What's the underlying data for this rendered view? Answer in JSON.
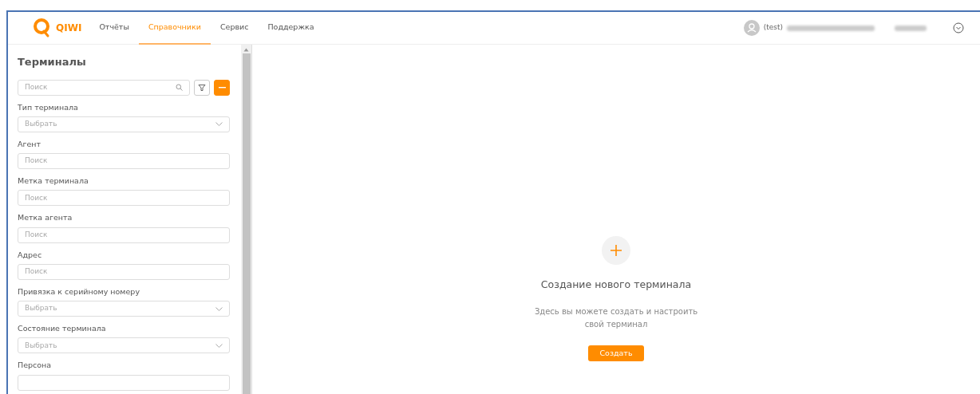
{
  "logo": {
    "text": "QIWI"
  },
  "nav": [
    {
      "label": "Отчёты",
      "selected": false
    },
    {
      "label": "Справочники",
      "selected": true
    },
    {
      "label": "Сервис",
      "selected": false
    },
    {
      "label": "Поддержка",
      "selected": false
    }
  ],
  "user": {
    "name": "(test)"
  },
  "sidebar": {
    "title": "Терминалы",
    "search": {
      "placeholder": "Поиск"
    },
    "filters": [
      {
        "label": "Тип терминала",
        "kind": "select",
        "placeholder": "Выбрать"
      },
      {
        "label": "Агент",
        "kind": "input",
        "placeholder": "Поиск"
      },
      {
        "label": "Метка терминала",
        "kind": "input",
        "placeholder": "Поиск"
      },
      {
        "label": "Метка агента",
        "kind": "input",
        "placeholder": "Поиск"
      },
      {
        "label": "Адрес",
        "kind": "input",
        "placeholder": "Поиск"
      },
      {
        "label": "Привязка к серийному номеру",
        "kind": "select",
        "placeholder": "Выбрать"
      },
      {
        "label": "Состояние терминала",
        "kind": "select",
        "placeholder": "Выбрать"
      },
      {
        "label": "Персона",
        "kind": "input"
      }
    ]
  },
  "empty_state": {
    "title": "Создание нового терминала",
    "text": "Здесь вы можете создать и настроить свой терминал",
    "button": "Создать"
  }
}
